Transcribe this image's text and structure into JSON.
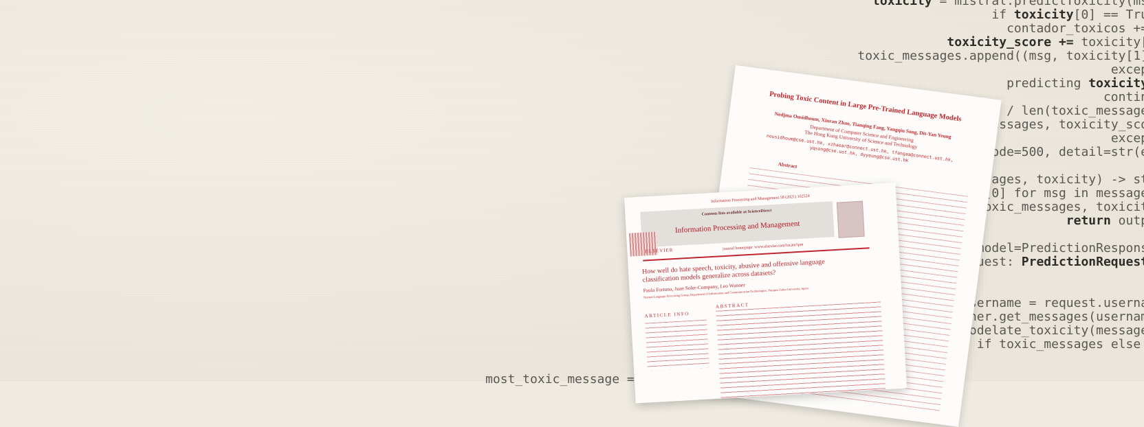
{
  "code_lines": [
    {
      "text": "toxicity = mistral.predictToxicity(ms",
      "bold": "toxicity"
    },
    {
      "text": "if toxicity[0] == Tru",
      "bold": "toxicity"
    },
    {
      "text": "contador_toxicos +=",
      "bold": ""
    },
    {
      "text": "toxicity_score += toxicity[",
      "bold": "toxicity_score +="
    },
    {
      "text": "toxic_messages.append((msg, toxicity[1]",
      "bold": ""
    },
    {
      "text": "excep",
      "bold": ""
    },
    {
      "text": "predicting toxicity",
      "bold": "toxicity"
    },
    {
      "text": "contin",
      "bold": ""
    },
    {
      "text": "e / len(toxic_message",
      "bold": ""
    },
    {
      "text": "essages, toxicity_sco",
      "bold": ""
    },
    {
      "text": "excep",
      "bold": ""
    },
    {
      "text": "code=500, detail=str(e",
      "bold": ""
    },
    {
      "text": "",
      "bold": ""
    },
    {
      "text": "sages, toxicity) -> st",
      "bold": ""
    },
    {
      "text": "g[0] for msg in message",
      "bold": ""
    },
    {
      "text": "toxic_messages, toxicit",
      "bold": ""
    },
    {
      "text": "return outp",
      "bold": "return"
    },
    {
      "text": "",
      "bold": ""
    },
    {
      "text": "_model=PredictionRespons",
      "bold": ""
    },
    {
      "text": "equest: PredictionRequest",
      "bold": "PredictionRequest"
    },
    {
      "text": "",
      "bold": ""
    },
    {
      "text": "",
      "bold": ""
    },
    {
      "text": "username = request.userna",
      "bold": ""
    },
    {
      "text": "ainer.get_messages(usernam",
      "bold": ""
    },
    {
      "text": "modelate_toxicity(message",
      "bold": ""
    },
    {
      "text": "if toxic_messages else ",
      "bold": ""
    }
  ],
  "code_bottom": "most_toxic_message =",
  "paper1": {
    "title": "Probing Toxic Content in Large Pre-Trained Language Models",
    "authors": "Nedjma Ousidhoum, Xinran Zhao, Tianqing Fang, Yangqiu Song, Dit-Yan Yeung",
    "affiliation_1": "Department of Computer Science and Engineering",
    "affiliation_2": "The Hong Kong University of Science and Technology",
    "emails_1": "nousidhoum@cse.ust.hk, xzhaoar@connect.ust.hk, tfangaa@connect.ust.hk,",
    "emails_2": "yqsong@cse.ust.hk, dyyeung@cse.ust.hk",
    "abstract_heading": "Abstract"
  },
  "paper2": {
    "journal_line": "Information Processing and Management 58 (2021) 102524",
    "contents_line": "Contents lists available at ScienceDirect",
    "journal_name": "Information Processing and Management",
    "homepage": "journal homepage: www.elsevier.com/locate/ipm",
    "publisher": "ELSEVIER",
    "title": "How well do hate speech, toxicity, abusive and offensive language classification models generalize across datasets?",
    "authors": "Paula Fortuna, Juan Soler-Company, Leo Wanner",
    "affiliation": "Natural Language Processing Group, Department of Information and Communication Technologies, Pompeu Fabra University, Spain",
    "article_info": "ARTICLE INFO",
    "abstract": "ABSTRACT"
  }
}
